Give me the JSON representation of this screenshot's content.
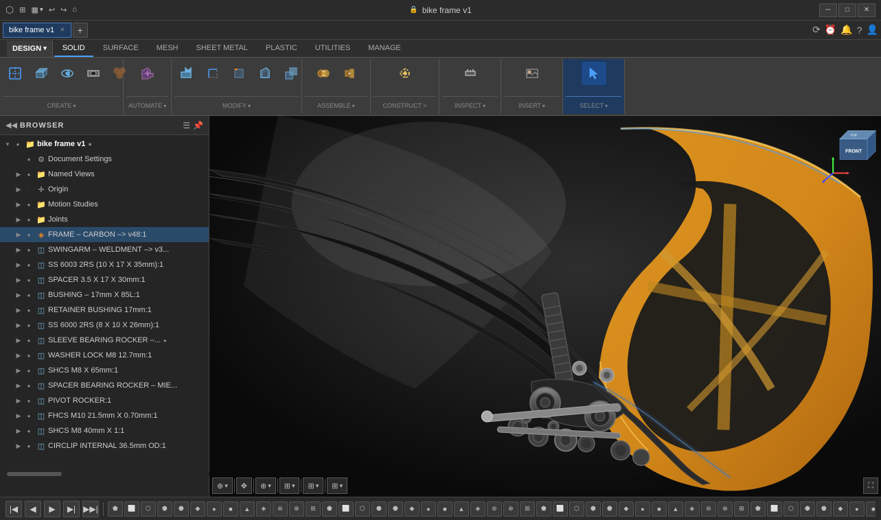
{
  "titleBar": {
    "title": "bike frame v1",
    "lockIcon": "🔒",
    "closeLabel": "✕",
    "minimizeLabel": "─",
    "maximizeLabel": "□"
  },
  "appTabs": {
    "tabs": [
      {
        "label": "bike frame v1",
        "active": true
      }
    ],
    "newTabLabel": "+",
    "icons": [
      "⟳",
      "⏰",
      "🔔",
      "?",
      "👤"
    ]
  },
  "toolbar": {
    "designLabel": "DESIGN",
    "designArrow": "▾",
    "tabs": [
      {
        "label": "SOLID",
        "active": true
      },
      {
        "label": "SURFACE",
        "active": false
      },
      {
        "label": "MESH",
        "active": false
      },
      {
        "label": "SHEET METAL",
        "active": false
      },
      {
        "label": "PLASTIC",
        "active": false
      },
      {
        "label": "UTILITIES",
        "active": false
      },
      {
        "label": "MANAGE",
        "active": false
      }
    ],
    "groups": [
      {
        "name": "CREATE",
        "hasArrow": true,
        "icons": [
          "create1",
          "create2",
          "create3",
          "create4",
          "create5"
        ]
      },
      {
        "name": "AUTOMATE",
        "hasArrow": true,
        "icons": [
          "automate1"
        ]
      },
      {
        "name": "MODIFY",
        "hasArrow": true,
        "icons": [
          "modify1",
          "modify2",
          "modify3",
          "modify4",
          "modify5"
        ]
      },
      {
        "name": "ASSEMBLE",
        "hasArrow": true,
        "icons": [
          "assemble1",
          "assemble2"
        ]
      },
      {
        "name": "CONSTRUCT >",
        "hasArrow": false,
        "icons": [
          "construct1"
        ]
      },
      {
        "name": "INSPECT",
        "hasArrow": true,
        "icons": [
          "inspect1"
        ]
      },
      {
        "name": "INSERT",
        "hasArrow": true,
        "icons": [
          "insert1"
        ]
      },
      {
        "name": "SELECT",
        "hasArrow": true,
        "icons": [
          "select1"
        ],
        "active": true
      }
    ]
  },
  "browser": {
    "title": "BROWSER",
    "collapseIcon": "◀",
    "pinIcon": "📌",
    "items": [
      {
        "indent": 0,
        "expand": "▾",
        "vis": "●",
        "iconType": "folder",
        "label": "bike frame v1",
        "bold": true,
        "extra": "●"
      },
      {
        "indent": 1,
        "expand": "",
        "vis": "●",
        "iconType": "gear",
        "label": "Document Settings",
        "bold": false
      },
      {
        "indent": 1,
        "expand": "▶",
        "vis": "●",
        "iconType": "folder",
        "label": "Named Views",
        "bold": false
      },
      {
        "indent": 1,
        "expand": "▶",
        "vis": "◌",
        "iconType": "origin",
        "label": "Origin",
        "bold": false
      },
      {
        "indent": 1,
        "expand": "▶",
        "vis": "●",
        "iconType": "folder",
        "label": "Motion Studies",
        "bold": false
      },
      {
        "indent": 1,
        "expand": "▶",
        "vis": "●",
        "iconType": "folder",
        "label": "Joints",
        "bold": false
      },
      {
        "indent": 1,
        "expand": "▶",
        "vis": "●",
        "iconType": "component-special",
        "label": "FRAME – CARBON –> v48:1",
        "bold": false,
        "highlighted": true
      },
      {
        "indent": 1,
        "expand": "▶",
        "vis": "●",
        "iconType": "component",
        "label": "SWINGARM – WELDMENT –> v3...",
        "bold": false
      },
      {
        "indent": 1,
        "expand": "▶",
        "vis": "●",
        "iconType": "component",
        "label": "SS 6003 2RS (10 X 17 X 35mm):1",
        "bold": false
      },
      {
        "indent": 1,
        "expand": "▶",
        "vis": "●",
        "iconType": "component",
        "label": "SPACER 3.5 X 17 X 30mm:1",
        "bold": false
      },
      {
        "indent": 1,
        "expand": "▶",
        "vis": "●",
        "iconType": "component",
        "label": "BUSHING – 17mm X 85L:1",
        "bold": false
      },
      {
        "indent": 1,
        "expand": "▶",
        "vis": "●",
        "iconType": "component",
        "label": "RETAINER BUSHING 17mm:1",
        "bold": false
      },
      {
        "indent": 1,
        "expand": "▶",
        "vis": "●",
        "iconType": "component",
        "label": "SS 6000 2RS (8 X 10 X 26mm):1",
        "bold": false
      },
      {
        "indent": 1,
        "expand": "▶",
        "vis": "●",
        "iconType": "component",
        "label": "SLEEVE BEARING ROCKER –...",
        "bold": false,
        "extraIcon": "●"
      },
      {
        "indent": 1,
        "expand": "▶",
        "vis": "●",
        "iconType": "component",
        "label": "WASHER LOCK M8 12.7mm:1",
        "bold": false
      },
      {
        "indent": 1,
        "expand": "▶",
        "vis": "●",
        "iconType": "component",
        "label": "SHCS M8 X 65mm:1",
        "bold": false
      },
      {
        "indent": 1,
        "expand": "▶",
        "vis": "●",
        "iconType": "component",
        "label": "SPACER BEARING ROCKER – MIE...",
        "bold": false
      },
      {
        "indent": 1,
        "expand": "▶",
        "vis": "●",
        "iconType": "component",
        "label": "PIVOT ROCKER:1",
        "bold": false
      },
      {
        "indent": 1,
        "expand": "▶",
        "vis": "●",
        "iconType": "component",
        "label": "FHCS M10 21.5mm X 0.70mm:1",
        "bold": false
      },
      {
        "indent": 1,
        "expand": "▶",
        "vis": "●",
        "iconType": "component",
        "label": "SHCS M8 40mm X 1:1",
        "bold": false
      },
      {
        "indent": 1,
        "expand": "▶",
        "vis": "●",
        "iconType": "component",
        "label": "CIRCLIP INTERNAL 36.5mm OD:1",
        "bold": false
      }
    ]
  },
  "viewport": {
    "title": "3D Viewport",
    "backgroundGradient": "radial-gradient(ellipse at 60% 40%, #2a2a2a 0%, #1a1a1a 100%)"
  },
  "navBar": {
    "buttons": [
      {
        "label": "⊕",
        "hasArrow": true
      },
      {
        "label": "⊞",
        "hasArrow": false
      },
      {
        "label": "↕",
        "hasArrow": false
      },
      {
        "label": "⊕",
        "hasArrow": true
      },
      {
        "label": "⊞",
        "hasArrow": true
      },
      {
        "label": "⊞",
        "hasArrow": true
      }
    ]
  },
  "statusBar": {
    "icons": [
      "↖",
      "◎",
      "⌖",
      "⊕",
      "⊞"
    ]
  },
  "timeline": {
    "playControls": [
      "|◀",
      "◀",
      "▶",
      "▶|",
      "▶▶|"
    ],
    "iconCount": 50
  }
}
